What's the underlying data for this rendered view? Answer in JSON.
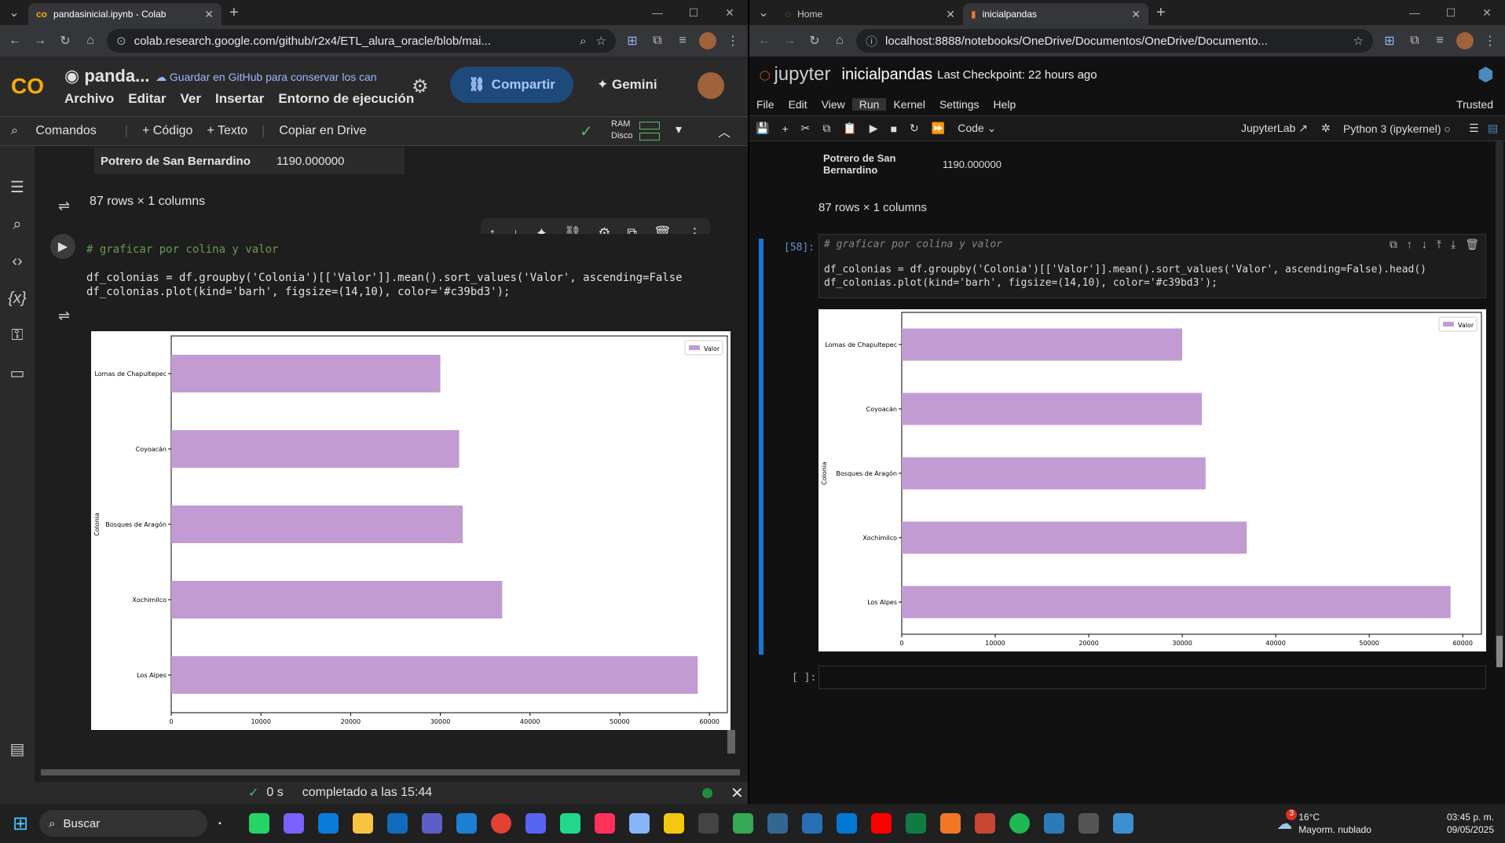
{
  "left_browser": {
    "tab_title": "pandasinicial.ipynb - Colab",
    "url": "colab.research.google.com/github/r2x4/ETL_alura_oracle/blob/mai...",
    "colab": {
      "logo": "CO",
      "notebook_title": "panda...",
      "github_save": "Guardar en GitHub para conservar los can",
      "menus": [
        "Archivo",
        "Editar",
        "Ver",
        "Insertar",
        "Entorno de ejecución"
      ],
      "share_label": "Compartir",
      "gemini_label": "Gemini",
      "toolbar": {
        "commands": "Comandos",
        "code": "+ Código",
        "text": "+ Texto",
        "copy_drive": "Copiar en Drive",
        "ram": "RAM",
        "disk": "Disco"
      },
      "output_row": {
        "name": "Potrero de San Bernardino",
        "value": "1190.000000"
      },
      "rows_info": "87 rows × 1 columns",
      "code_lines": [
        "# graficar por colina y valor",
        "df_colonias = df.groupby('Colonia')[['Valor']].mean().sort_values('Valor', ascending=False",
        "df_colonias.plot(kind='barh', figsize=(14,10), color='#c39bd3');"
      ],
      "exec_time": "0 s",
      "status": "completado a las 15:44"
    }
  },
  "right_browser": {
    "tab_home": "Home",
    "tab_title": "inicialpandas",
    "url": "localhost:8888/notebooks/OneDrive/Documentos/OneDrive/Documento...",
    "jupyter": {
      "logo_text": "jupyter",
      "notebook_name": "inicialpandas",
      "checkpoint": "Last Checkpoint: 22 hours ago",
      "menus": [
        "File",
        "Edit",
        "View",
        "Run",
        "Kernel",
        "Settings",
        "Help"
      ],
      "trusted": "Trusted",
      "cell_type": "Code",
      "jupyterlab": "JupyterLab",
      "kernel": "Python 3 (ipykernel)",
      "output_row": {
        "name": "Potrero de San Bernardino",
        "value": "1190.000000"
      },
      "rows_info": "87 rows × 1 columns",
      "prompt": "[58]:",
      "empty_prompt": "[ ]:",
      "code_lines": [
        "# graficar por colina y valor",
        "df_colonias = df.groupby('Colonia')[['Valor']].mean().sort_values('Valor', ascending=False).head()",
        "df_colonias.plot(kind='barh', figsize=(14,10), color='#c39bd3');"
      ]
    }
  },
  "chart_data": {
    "type": "bar",
    "orientation": "horizontal",
    "categories": [
      "Los Alpes",
      "Xochimilco",
      "Bosques de Aragón",
      "Coyoacán",
      "Lomas de Chapultepec"
    ],
    "values": [
      58700,
      36900,
      32500,
      32100,
      30000
    ],
    "ylabel": "Colonia",
    "legend": "Valor",
    "legend_position": "top-right",
    "xticks": [
      0,
      10000,
      20000,
      30000,
      40000,
      50000,
      60000
    ],
    "xlim": [
      0,
      62000
    ],
    "color": "#c39bd3"
  },
  "taskbar": {
    "search": "Buscar",
    "weather_temp": "16°C",
    "weather_desc": "Mayorm. nublado",
    "weather_badge": "3",
    "time": "03:45 p. m.",
    "date": "09/05/2025"
  }
}
